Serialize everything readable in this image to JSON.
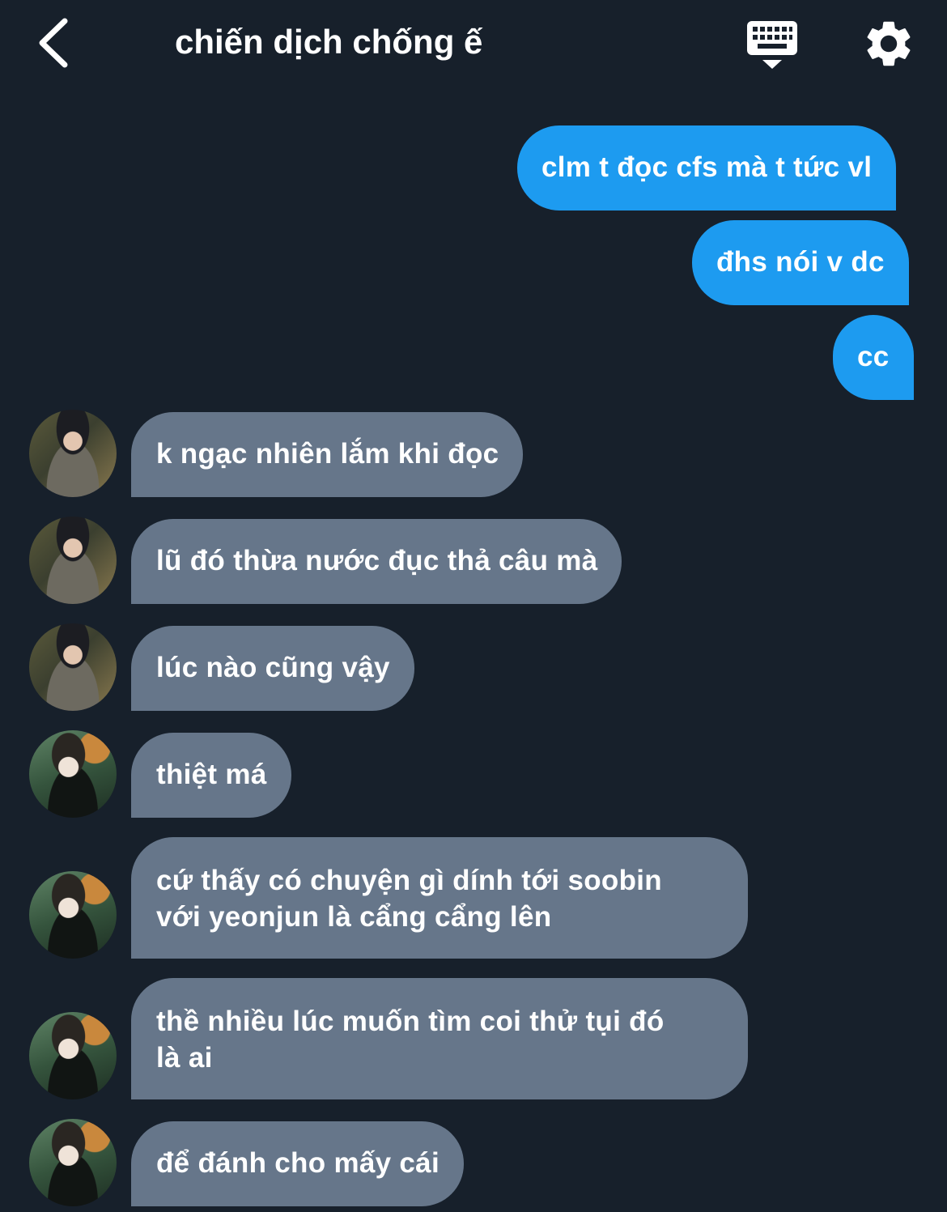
{
  "header": {
    "title": "chiến dịch chống ế"
  },
  "icons": {
    "back": "chevron-left-icon",
    "keyboard": "keyboard-icon",
    "settings": "gear-icon"
  },
  "colors": {
    "background": "#17202b",
    "outgoing_bubble": "#1d9bf0",
    "incoming_bubble": "#66768a",
    "text": "#ffffff"
  },
  "messages": {
    "outgoing": [
      "clm t đọc cfs mà t tức vl",
      "đhs nói v dc",
      "cc"
    ],
    "incoming": [
      {
        "text": "k ngạc nhiên lắm khi đọc"
      },
      {
        "text": "lũ đó thừa nước đục thả câu mà"
      },
      {
        "text": "lúc nào cũng vậy"
      },
      {
        "text": "thiệt má"
      },
      {
        "lines": [
          "cứ thấy có chuyện gì dính tới soobin",
          "với yeonjun là cẩng cẩng lên"
        ]
      },
      {
        "lines": [
          "thề nhiều lúc muốn tìm coi thử tụi đó",
          "là ai"
        ]
      },
      {
        "text": "để đánh cho mấy cái"
      }
    ]
  }
}
